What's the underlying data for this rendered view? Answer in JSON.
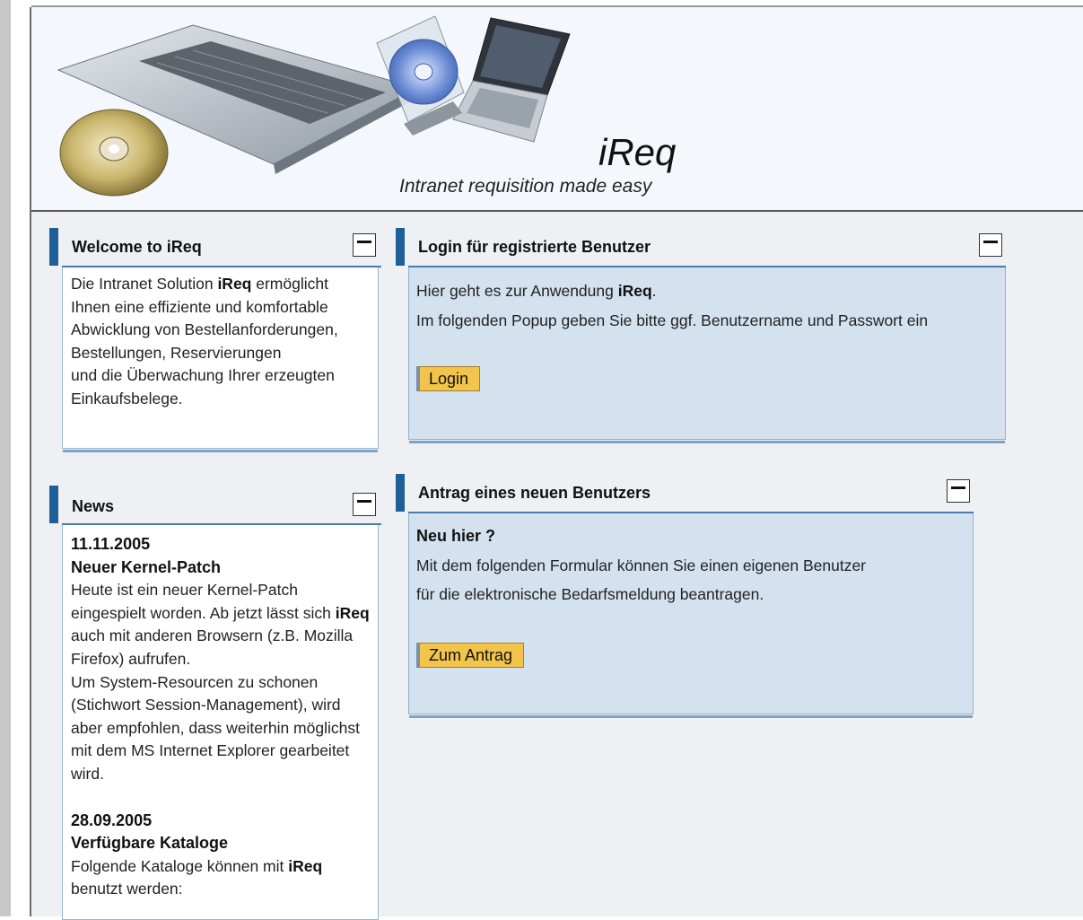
{
  "header": {
    "app_title": "iReq",
    "tagline": "Intranet requisition made easy"
  },
  "welcome": {
    "title": "Welcome to iReq",
    "text_1": "Die Intranet Solution ",
    "text_bold": "iReq",
    "text_2": " ermöglicht Ihnen eine effiziente und komfortable Abwicklung von Bestellanforderungen, Bestellungen, Reservierungen",
    "text_3": "und die Überwachung Ihrer erzeugten Einkaufsbelege."
  },
  "news": {
    "title": "News",
    "items": [
      {
        "date": "11.11.2005",
        "headline": "Neuer Kernel-Patch",
        "text_1": "Heute ist ein neuer Kernel-Patch eingespielt worden. Ab jetzt lässt sich ",
        "text_bold": "iReq",
        "text_2": " auch mit anderen Browsern (z.B. Mozilla Firefox) aufrufen.",
        "text_3": "Um System-Resourcen zu schonen (Stichwort Session-Management), wird aber empfohlen, dass weiterhin möglichst mit dem MS Internet Explorer gearbeitet wird."
      },
      {
        "date": "28.09.2005",
        "headline": "Verfügbare Kataloge",
        "text_1": "Folgende Kataloge können mit ",
        "text_bold": "iReq",
        "text_2": " benutzt werden:"
      }
    ]
  },
  "login": {
    "title": "Login für registrierte Benutzer",
    "line1_pre": "Hier geht es zur Anwendung ",
    "line1_bold": "iReq",
    "line1_post": ".",
    "line2": "Im folgenden Popup geben Sie bitte ggf. Benutzername und Passwort ein",
    "button": "Login"
  },
  "register": {
    "title": "Antrag eines neuen Benutzers",
    "subtitle": "Neu hier ?",
    "line1": "Mit dem folgenden Formular können Sie einen eigenen Benutzer",
    "line2": "für die elektronische Bedarfsmeldung beantragen.",
    "button": "Zum Antrag"
  },
  "colors": {
    "accent_bar": "#1c5f99",
    "panel_blue": "#d4e2f0",
    "button_yellow": "#f2c44a"
  }
}
